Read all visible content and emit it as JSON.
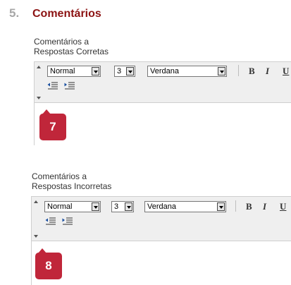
{
  "section": {
    "number": "5.",
    "title": "Comentários"
  },
  "editors": [
    {
      "label_line1": "Comentários a",
      "label_line2": "Respostas Corretas",
      "format_value": "Normal",
      "size_value": "3",
      "font_value": "Verdana",
      "bold": "B",
      "italic": "I",
      "underline": "U",
      "callout": "7"
    },
    {
      "label_line1": "Comentários a",
      "label_line2": "Respostas Incorretas",
      "format_value": "Normal",
      "size_value": "3",
      "font_value": "Verdana",
      "bold": "B",
      "italic": "I",
      "underline": "U",
      "callout": "8"
    }
  ],
  "colors": {
    "accent": "#8c1313",
    "badge": "#c0263a",
    "number": "#a7a7a7"
  }
}
